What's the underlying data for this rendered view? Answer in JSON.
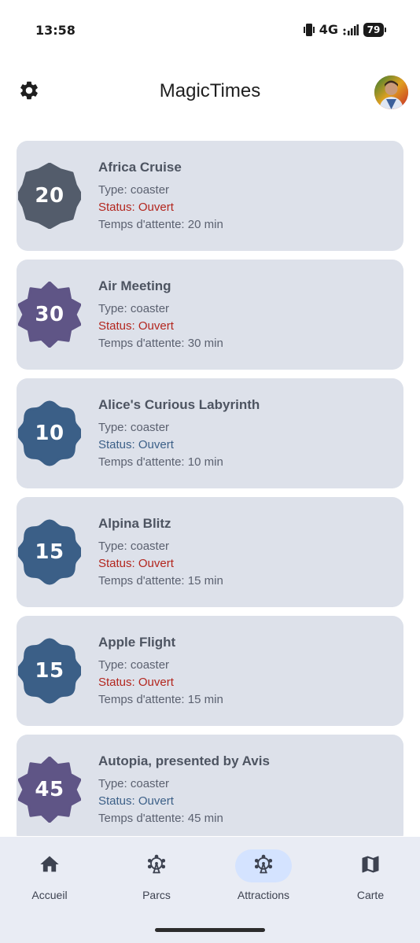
{
  "status_bar": {
    "time": "13:58",
    "network": "4G",
    "battery": "79"
  },
  "app_bar": {
    "title": "MagicTimes",
    "settings_icon": "gear-icon",
    "avatar_icon": "user-avatar"
  },
  "attractions": [
    {
      "name": "Africa Cruise",
      "badge": "20",
      "badge_color": "#535c6b",
      "badge_shape": "octagon-star",
      "type": "Type: coaster",
      "status": "Status: Ouvert",
      "status_color": "#b3261e",
      "wait": "Temps d'attente: 20 min"
    },
    {
      "name": "Air Meeting",
      "badge": "30",
      "badge_color": "#5f5586",
      "badge_shape": "star",
      "type": "Type: coaster",
      "status": "Status: Ouvert",
      "status_color": "#b3261e",
      "wait": "Temps d'attente: 30 min"
    },
    {
      "name": "Alice's Curious Labyrinth",
      "badge": "10",
      "badge_color": "#3b5f87",
      "badge_shape": "flower",
      "type": "Type: coaster",
      "status": "Status: Ouvert",
      "status_color": "#3b5f87",
      "wait": "Temps d'attente: 10 min"
    },
    {
      "name": "Alpina Blitz",
      "badge": "15",
      "badge_color": "#3b5f87",
      "badge_shape": "flower",
      "type": "Type: coaster",
      "status": "Status: Ouvert",
      "status_color": "#b3261e",
      "wait": "Temps d'attente: 15 min"
    },
    {
      "name": "Apple Flight",
      "badge": "15",
      "badge_color": "#3b5f87",
      "badge_shape": "flower",
      "type": "Type: coaster",
      "status": "Status: Ouvert",
      "status_color": "#b3261e",
      "wait": "Temps d'attente: 15 min"
    },
    {
      "name": "Autopia, presented by Avis",
      "badge": "45",
      "badge_color": "#5f5586",
      "badge_shape": "star",
      "type": "Type: coaster",
      "status": "Status: Ouvert",
      "status_color": "#3b5f87",
      "wait": "Temps d'attente: 45 min"
    }
  ],
  "nav": [
    {
      "label": "Accueil",
      "icon": "home-icon",
      "active": false
    },
    {
      "label": "Parcs",
      "icon": "ferris-wheel-icon",
      "active": false
    },
    {
      "label": "Attractions",
      "icon": "ferris-wheel-icon",
      "active": true
    },
    {
      "label": "Carte",
      "icon": "map-icon",
      "active": false
    }
  ]
}
